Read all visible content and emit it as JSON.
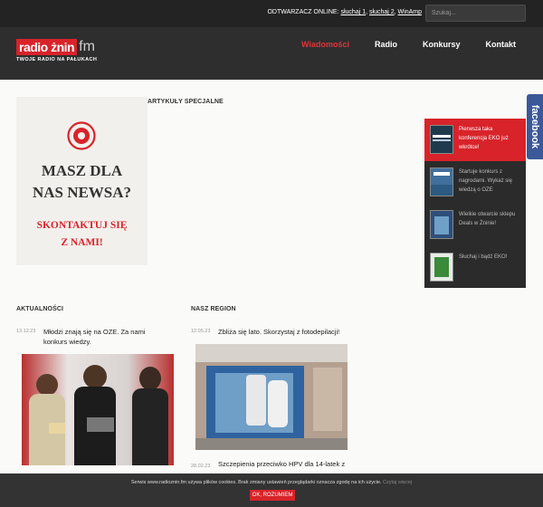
{
  "topbar": {
    "player_label": "ODTWARZACZ ONLINE:",
    "links": [
      "słuchaj 1",
      "słuchaj 2",
      "WinAmp"
    ],
    "search_placeholder": "Szukaj..."
  },
  "logo": {
    "name": "radio żnin",
    "fm": "fm",
    "slogan": "TWOJE RADIO NA PAŁUKACH"
  },
  "nav": [
    "Wiadomości",
    "Radio",
    "Konkursy",
    "Kontakt"
  ],
  "sections": {
    "special": "ARTYKUŁY SPECJALNE",
    "news": "AKTUALNOŚCI",
    "region": "NASZ REGION"
  },
  "ad": {
    "line1": "MASZ DLA",
    "line2": "NAS NEWSA?",
    "red1": "SKONTAKTUJ SIĘ",
    "red2": "Z NAMI!"
  },
  "facebook_tab": "facebook",
  "special_articles": [
    {
      "title": "Pierwsza taka konferencja EKO już wkrótce!",
      "active": true
    },
    {
      "title": "Startuje konkurs z nagrodami. Wykaż się wiedzą o OZE",
      "active": false
    },
    {
      "title": "Wielkie otwarcie sklepu Deals w Żninie!",
      "active": false
    },
    {
      "title": "Słuchaj i bądź EKO!",
      "active": false
    }
  ],
  "news": [
    {
      "date": "13.12.23",
      "title": "Młodzi znają się na OZE. Za nami konkurs wiedzy."
    }
  ],
  "region": [
    {
      "date": "12.05.23",
      "title": "Zbliża się lato. Skorzystaj z fotodepilacji!"
    },
    {
      "date": "28.02.23",
      "title": "Szczepienia przeciwko HPV dla 14-latek z"
    }
  ],
  "cookie": {
    "text": "Serwis www.radioznin.fm używa plików cookies. Brak zmiany ustawień przeglądarki oznacza zgodę na ich użycie.",
    "more": "Czytaj więcej",
    "button": "OK, ROZUMIEM"
  },
  "colors": {
    "accent": "#d8232a",
    "topbar": "#232323",
    "header": "#2e2e2e",
    "facebook": "#3b5998"
  }
}
